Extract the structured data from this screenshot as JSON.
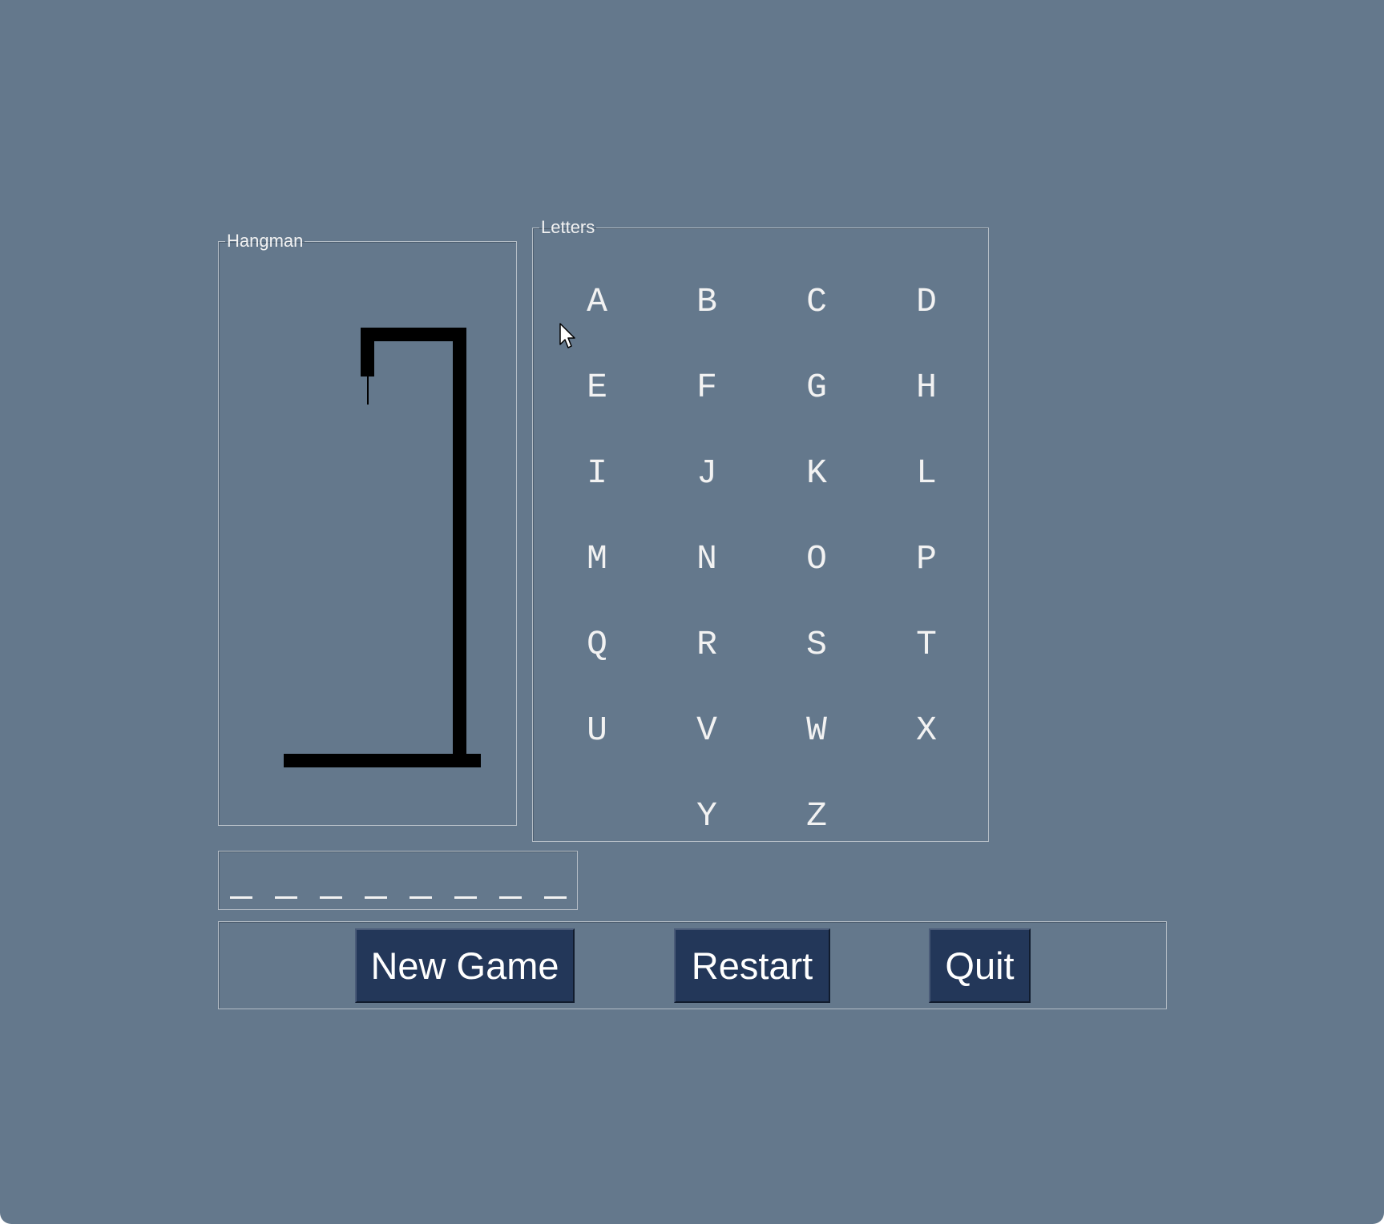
{
  "hangman_panel": {
    "title": "Hangman",
    "wrong_guesses": 0
  },
  "letters_panel": {
    "title": "Letters",
    "letters": [
      "A",
      "B",
      "C",
      "D",
      "E",
      "F",
      "G",
      "H",
      "I",
      "J",
      "K",
      "L",
      "M",
      "N",
      "O",
      "P",
      "Q",
      "R",
      "S",
      "T",
      "U",
      "V",
      "W",
      "X",
      "Y",
      "Z"
    ]
  },
  "word": {
    "length": 8,
    "revealed": [
      "_",
      "_",
      "_",
      "_",
      "_",
      "_",
      "_",
      "_"
    ]
  },
  "buttons": {
    "new_game": "New Game",
    "restart": "Restart",
    "quit": "Quit"
  },
  "colors": {
    "background": "#64788c",
    "button": "#233759",
    "text": "#f2f2f2",
    "gallows": "#000000"
  }
}
